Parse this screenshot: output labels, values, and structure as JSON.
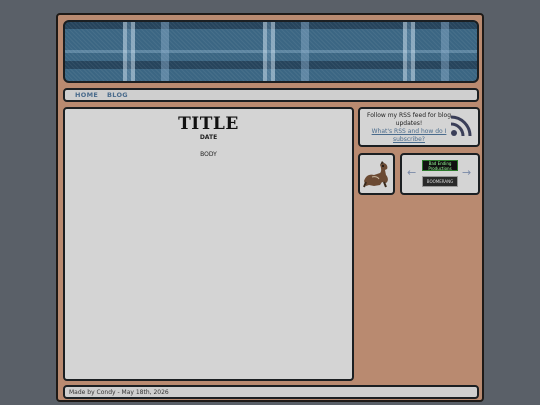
{
  "nav": {
    "items": [
      {
        "label": "HOME"
      },
      {
        "label": "BLOG"
      }
    ]
  },
  "post": {
    "title": "TITLE",
    "date": "DATE",
    "body": "BODY"
  },
  "sidebar": {
    "rss_text": "Follow my RSS feed for blog updates!",
    "rss_link": "What's RSS and how do I subscribe?",
    "buttons": [
      "Bad Ending Productions",
      "BOOMERANG"
    ]
  },
  "footer": {
    "text": "Made by Condy - May 18th, 2026"
  },
  "colors": {
    "frame": "#b98a70",
    "panel": "#d4d4d4",
    "link": "#4a6b8c",
    "banner": "#3b6683"
  },
  "icons": [
    "rss-icon",
    "horse-icon",
    "arrow-left-icon",
    "arrow-right-icon"
  ]
}
